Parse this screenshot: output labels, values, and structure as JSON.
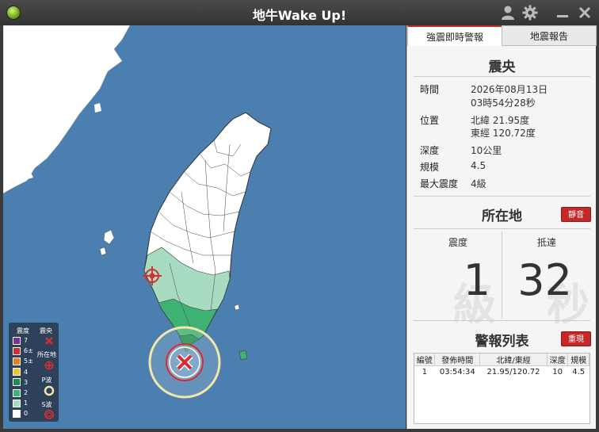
{
  "window": {
    "title": "地牛Wake Up!"
  },
  "tabs": {
    "alert": "強震即時警報",
    "report": "地震報告"
  },
  "epicenter": {
    "heading": "震央",
    "time_label": "時間",
    "time_date": "2026年08月13日",
    "time_clock": "03時54分28秒",
    "location_label": "位置",
    "lat": "北緯 21.95度",
    "lon": "東經 120.72度",
    "depth_label": "深度",
    "depth": "10公里",
    "magnitude_label": "規模",
    "magnitude": "4.5",
    "max_intensity_label": "最大震度",
    "max_intensity": "4級"
  },
  "local": {
    "heading": "所在地",
    "mute_label": "靜音",
    "intensity_label": "震度",
    "intensity_value": "1",
    "intensity_bg": "級",
    "arrival_label": "抵達",
    "arrival_value": "32",
    "arrival_bg": "秒"
  },
  "alerts": {
    "heading": "警報列表",
    "replay_label": "重現",
    "columns": [
      "編號",
      "發佈時間",
      "北緯/東經",
      "深度",
      "規模"
    ],
    "rows": [
      [
        "1",
        "03:54:34",
        "21.95/120.72",
        "10",
        "4.5"
      ]
    ]
  },
  "legend": {
    "intensity_header": "震度",
    "epicenter_header": "震央",
    "levels": [
      "7",
      "6±",
      "5±",
      "4",
      "3",
      "2",
      "1",
      "0"
    ],
    "level_colors": [
      "#7b2fa0",
      "#d32f2f",
      "#e67e22",
      "#f1c232",
      "#1e8f4e",
      "#3fb173",
      "#a8dcc0",
      "#ffffff"
    ],
    "location_label": "所在地",
    "p_wave_label": "P波",
    "s_wave_label": "S波"
  },
  "colors": {
    "accent": "#c62828",
    "sea": "#4b7fb0",
    "land": "#ffffff",
    "shake1": "#a8dcc0",
    "shake2": "#3fb173",
    "shake3": "#1e8f4e"
  }
}
